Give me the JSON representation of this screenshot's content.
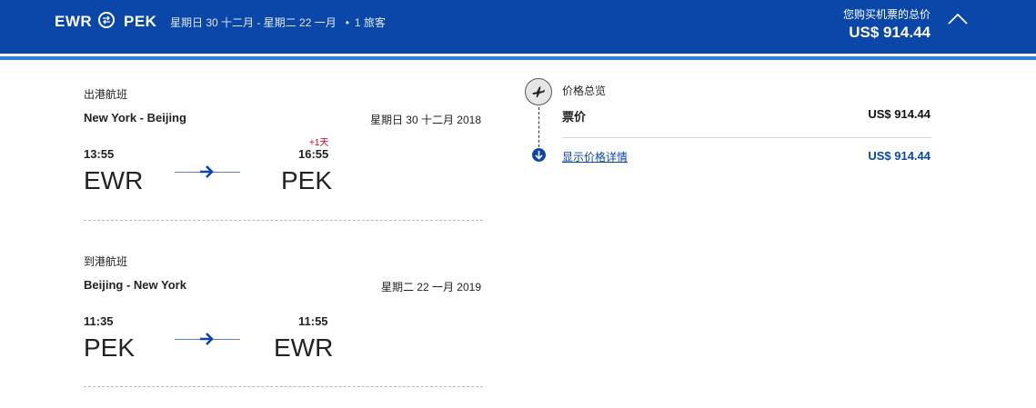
{
  "header": {
    "origin": "EWR",
    "destination": "PEK",
    "swap_icon": "round-trip-icon",
    "dates": "星期日 30 十二月 - 星期二 22 一月",
    "separator": "•",
    "passengers": "1 旅客",
    "total_label": "您购买机票的总价",
    "total_value": "US$ 914.44",
    "collapse_icon": "chevron-up-icon",
    "colors": {
      "bar": "#0a47a9",
      "accent_line": "#2f7fe0"
    }
  },
  "outbound": {
    "label": "出港航班",
    "route": "New York - Beijing",
    "date": "星期日 30 十二月 2018",
    "depart_time": "13:55",
    "arrive_time": "16:55",
    "day_offset": "+1天",
    "from": "EWR",
    "to": "PEK"
  },
  "inbound": {
    "label": "到港航班",
    "route": "Beijing - New York",
    "date": "星期二 22 一月 2019",
    "depart_time": "11:35",
    "arrive_time": "11:55",
    "from": "PEK",
    "to": "EWR"
  },
  "price": {
    "title": "价格总览",
    "ticket_label": "票价",
    "ticket_value": "US$ 914.44",
    "details_link": "显示价格详情",
    "details_value": "US$ 914.44",
    "plane_icon": "airplane-icon",
    "details_icon": "arrow-down-icon"
  }
}
